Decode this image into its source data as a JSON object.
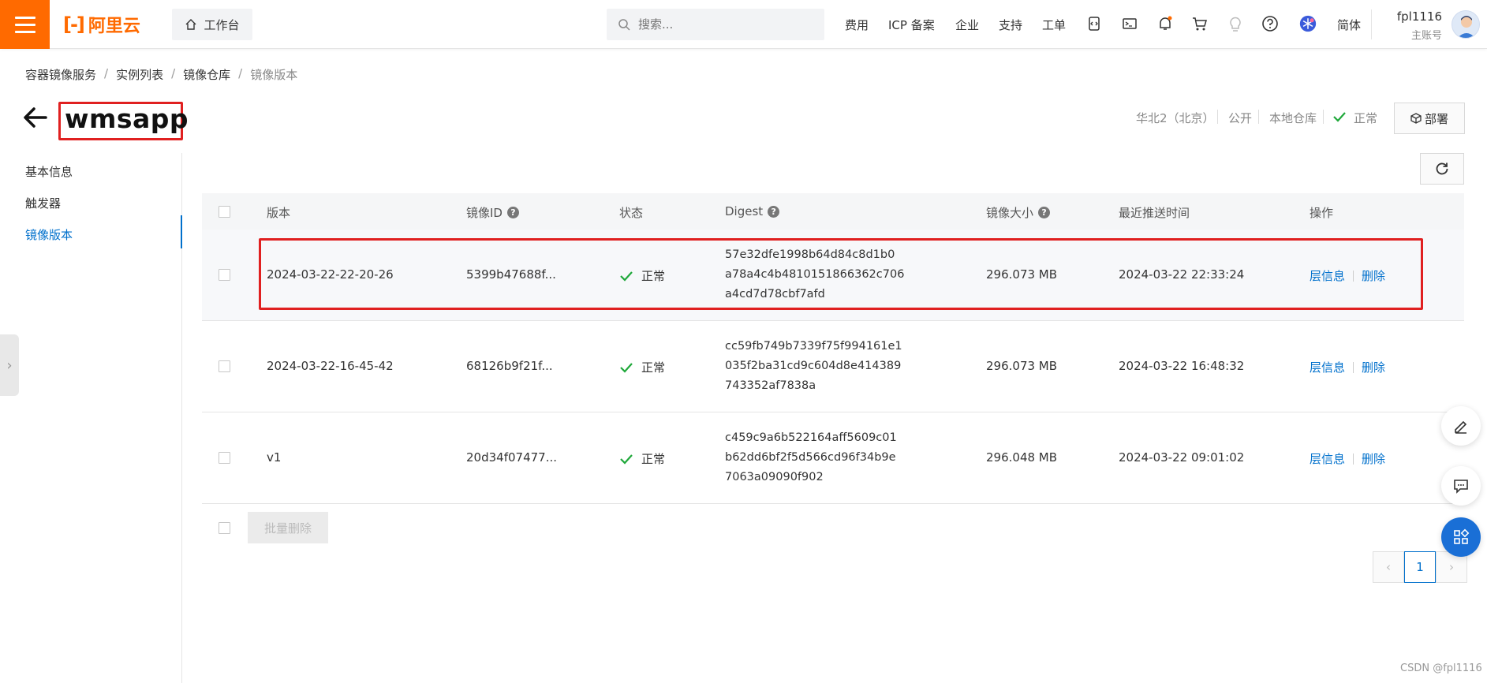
{
  "topbar": {
    "brand": "阿里云",
    "workbench_label": "工作台",
    "search_placeholder": "搜索...",
    "nav": [
      "费用",
      "ICP 备案",
      "企业",
      "支持",
      "工单"
    ],
    "language": "简体",
    "user_name": "fpl1116",
    "user_role": "主账号",
    "accent_color": "#ff6a00"
  },
  "breadcrumb": [
    "容器镜像服务",
    "实例列表",
    "镜像仓库",
    "镜像版本"
  ],
  "page": {
    "title": "wmsapp",
    "region": "华北2（北京）",
    "visibility": "公开",
    "repo_type": "本地仓库",
    "status": "正常",
    "deploy_label": "部署"
  },
  "sidemenu": [
    "基本信息",
    "触发器",
    "镜像版本"
  ],
  "table": {
    "headers": [
      "版本",
      "镜像ID",
      "状态",
      "Digest",
      "镜像大小",
      "最近推送时间",
      "操作"
    ],
    "rows": [
      {
        "version": "2024-03-22-22-20-26",
        "image_id": "5399b47688f...",
        "status": "正常",
        "digest": [
          "57e32dfe1998b64d84c8d1b0",
          "a78a4c4b4810151866362c706",
          "a4cd7d78cbf7afd"
        ],
        "size": "296.073 MB",
        "pushed": "2024-03-22 22:33:24",
        "op_layers": "层信息",
        "op_delete": "删除"
      },
      {
        "version": "2024-03-22-16-45-42",
        "image_id": "68126b9f21f...",
        "status": "正常",
        "digest": [
          "cc59fb749b7339f75f994161e1",
          "035f2ba31cd9c604d8e414389",
          "743352af7838a"
        ],
        "size": "296.073 MB",
        "pushed": "2024-03-22 16:48:32",
        "op_layers": "层信息",
        "op_delete": "删除"
      },
      {
        "version": "v1",
        "image_id": "20d34f07477...",
        "status": "正常",
        "digest": [
          "c459c9a6b522164aff5609c01",
          "b62dd6bf2f5d566cd96f34b9e",
          "7063a09090f902"
        ],
        "size": "296.048 MB",
        "pushed": "2024-03-22 09:01:02",
        "op_layers": "层信息",
        "op_delete": "删除"
      }
    ],
    "batch_delete_label": "批量删除"
  },
  "pagination": {
    "current": "1"
  },
  "watermark": "CSDN @fpl1116"
}
